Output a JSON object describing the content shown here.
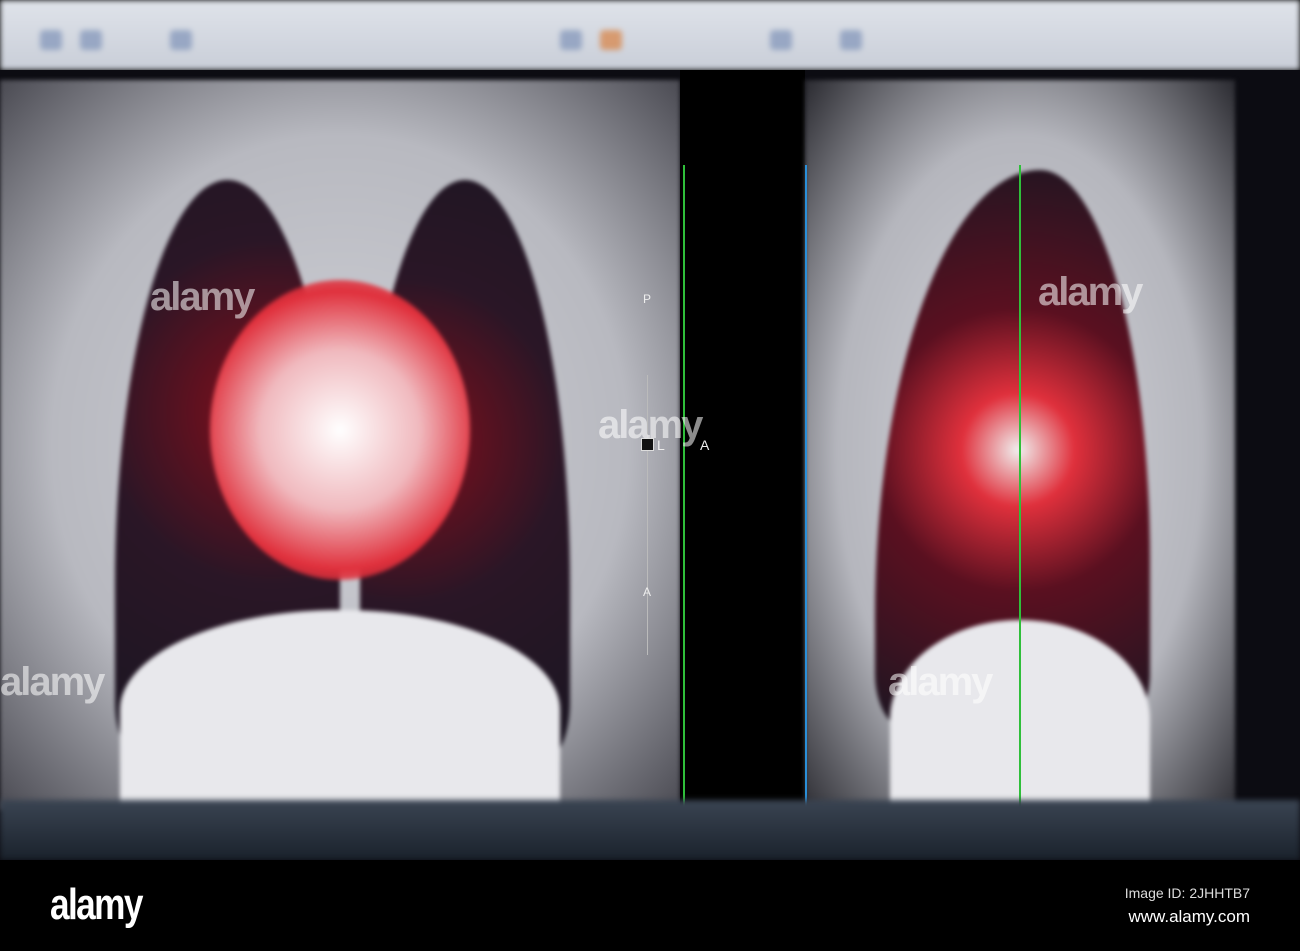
{
  "viewer": {
    "orientation_labels": {
      "top": "P",
      "bottom": "A",
      "left_marker": "L",
      "right_marker": "A"
    }
  },
  "watermark": {
    "text": "alamy"
  },
  "footer": {
    "logo": "alamy",
    "image_id": "Image ID: 2JHHTB7",
    "url": "www.alamy.com"
  },
  "colors": {
    "crosshair_green": "#2fbf3a",
    "crosshair_blue": "#2a8fd8",
    "highlight_red": "#e0303c"
  }
}
